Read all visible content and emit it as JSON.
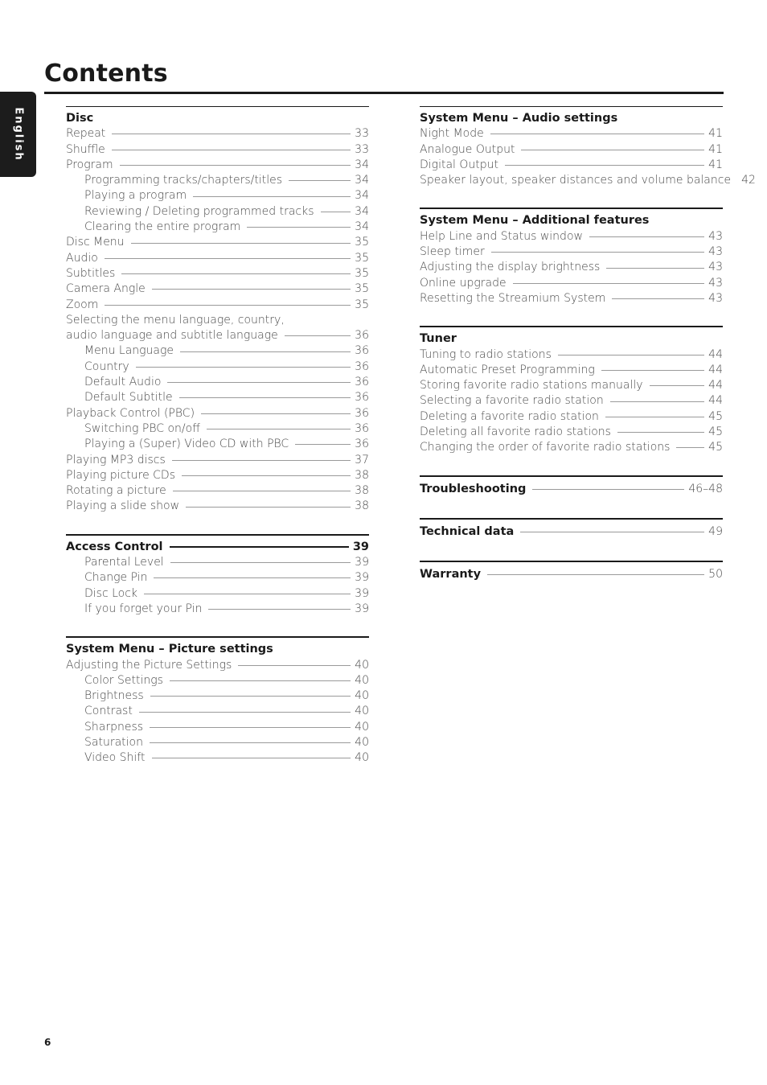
{
  "page_title": "Contents",
  "language_tab": "English",
  "page_number": "6",
  "left_column": [
    {
      "heading": "Disc",
      "entries": [
        {
          "label": "Repeat",
          "page": "33",
          "level": 0
        },
        {
          "label": "Shuffle",
          "page": "33",
          "level": 0
        },
        {
          "label": "Program",
          "page": "34",
          "level": 0
        },
        {
          "label": "Programming tracks/chapters/titles",
          "page": "34",
          "level": 1
        },
        {
          "label": "Playing a program",
          "page": "34",
          "level": 1
        },
        {
          "label": "Reviewing / Deleting programmed tracks",
          "page": "34",
          "level": 1
        },
        {
          "label": "Clearing the entire program",
          "page": "34",
          "level": 1
        },
        {
          "label": "Disc Menu",
          "page": "35",
          "level": 0
        },
        {
          "label": "Audio",
          "page": "35",
          "level": 0
        },
        {
          "label": "Subtitles",
          "page": "35",
          "level": 0
        },
        {
          "label": "Camera Angle",
          "page": "35",
          "level": 0
        },
        {
          "label": "Zoom",
          "page": "35",
          "level": 0
        },
        {
          "label": "Selecting the menu language, country,",
          "page": "",
          "level": 0,
          "no_leader": true
        },
        {
          "label": "audio language and subtitle language",
          "page": "36",
          "level": 0
        },
        {
          "label": "Menu Language",
          "page": "36",
          "level": 1
        },
        {
          "label": "Country",
          "page": "36",
          "level": 1
        },
        {
          "label": "Default Audio",
          "page": "36",
          "level": 1
        },
        {
          "label": "Default Subtitle",
          "page": "36",
          "level": 1
        },
        {
          "label": "Playback Control (PBC)",
          "page": "36",
          "level": 0
        },
        {
          "label": "Switching PBC on/off",
          "page": "36",
          "level": 1
        },
        {
          "label": "Playing a (Super) Video CD with PBC",
          "page": "36",
          "level": 1
        },
        {
          "label": "Playing MP3 discs",
          "page": "37",
          "level": 0
        },
        {
          "label": "Playing picture CDs",
          "page": "38",
          "level": 0
        },
        {
          "label": "Rotating a picture",
          "page": "38",
          "level": 0
        },
        {
          "label": "Playing a slide show",
          "page": "38",
          "level": 0
        }
      ]
    },
    {
      "heading": "Access Control",
      "heading_page": "39",
      "entries": [
        {
          "label": "Parental Level",
          "page": "39",
          "level": 1
        },
        {
          "label": "Change Pin",
          "page": "39",
          "level": 1
        },
        {
          "label": "Disc Lock",
          "page": "39",
          "level": 1
        },
        {
          "label": "If you forget your Pin",
          "page": "39",
          "level": 1
        }
      ]
    },
    {
      "heading": "System Menu – Picture settings",
      "entries": [
        {
          "label": "Adjusting the Picture Settings",
          "page": "40",
          "level": 0
        },
        {
          "label": "Color Settings",
          "page": "40",
          "level": 1
        },
        {
          "label": "Brightness",
          "page": "40",
          "level": 1
        },
        {
          "label": "Contrast",
          "page": "40",
          "level": 1
        },
        {
          "label": "Sharpness",
          "page": "40",
          "level": 1
        },
        {
          "label": "Saturation",
          "page": "40",
          "level": 1
        },
        {
          "label": "Video Shift",
          "page": "40",
          "level": 1
        }
      ]
    }
  ],
  "right_column": [
    {
      "heading": "System Menu – Audio settings",
      "entries": [
        {
          "label": "Night Mode",
          "page": "41",
          "level": 0
        },
        {
          "label": "Analogue Output",
          "page": "41",
          "level": 0
        },
        {
          "label": "Digital Output",
          "page": "41",
          "level": 0
        },
        {
          "label": "Speaker layout, speaker distances and volume balance",
          "page": "42",
          "level": 0
        }
      ]
    },
    {
      "heading": "System Menu – Additional features",
      "entries": [
        {
          "label": "Help Line and Status window",
          "page": "43",
          "level": 0
        },
        {
          "label": "Sleep timer",
          "page": "43",
          "level": 0
        },
        {
          "label": "Adjusting the display brightness",
          "page": "43",
          "level": 0
        },
        {
          "label": "Online upgrade",
          "page": "43",
          "level": 0
        },
        {
          "label": "Resetting the Streamium System",
          "page": "43",
          "level": 0
        }
      ]
    },
    {
      "heading": "Tuner",
      "entries": [
        {
          "label": "Tuning to radio stations",
          "page": "44",
          "level": 0
        },
        {
          "label": "Automatic Preset Programming",
          "page": "44",
          "level": 0
        },
        {
          "label": "Storing favorite radio stations manually",
          "page": "44",
          "level": 0
        },
        {
          "label": "Selecting a favorite radio station",
          "page": "44",
          "level": 0
        },
        {
          "label": "Deleting a favorite radio station",
          "page": "45",
          "level": 0
        },
        {
          "label": "Deleting all favorite radio stations",
          "page": "45",
          "level": 0
        },
        {
          "label": "Changing the order of favorite radio stations",
          "page": "45",
          "level": 0
        }
      ]
    },
    {
      "heading": "Troubleshooting",
      "heading_page": "46–48",
      "single": true,
      "entries": []
    },
    {
      "heading": "Technical data",
      "heading_page": "49",
      "single": true,
      "entries": []
    },
    {
      "heading": "Warranty",
      "heading_page": "50",
      "single": true,
      "entries": []
    }
  ]
}
